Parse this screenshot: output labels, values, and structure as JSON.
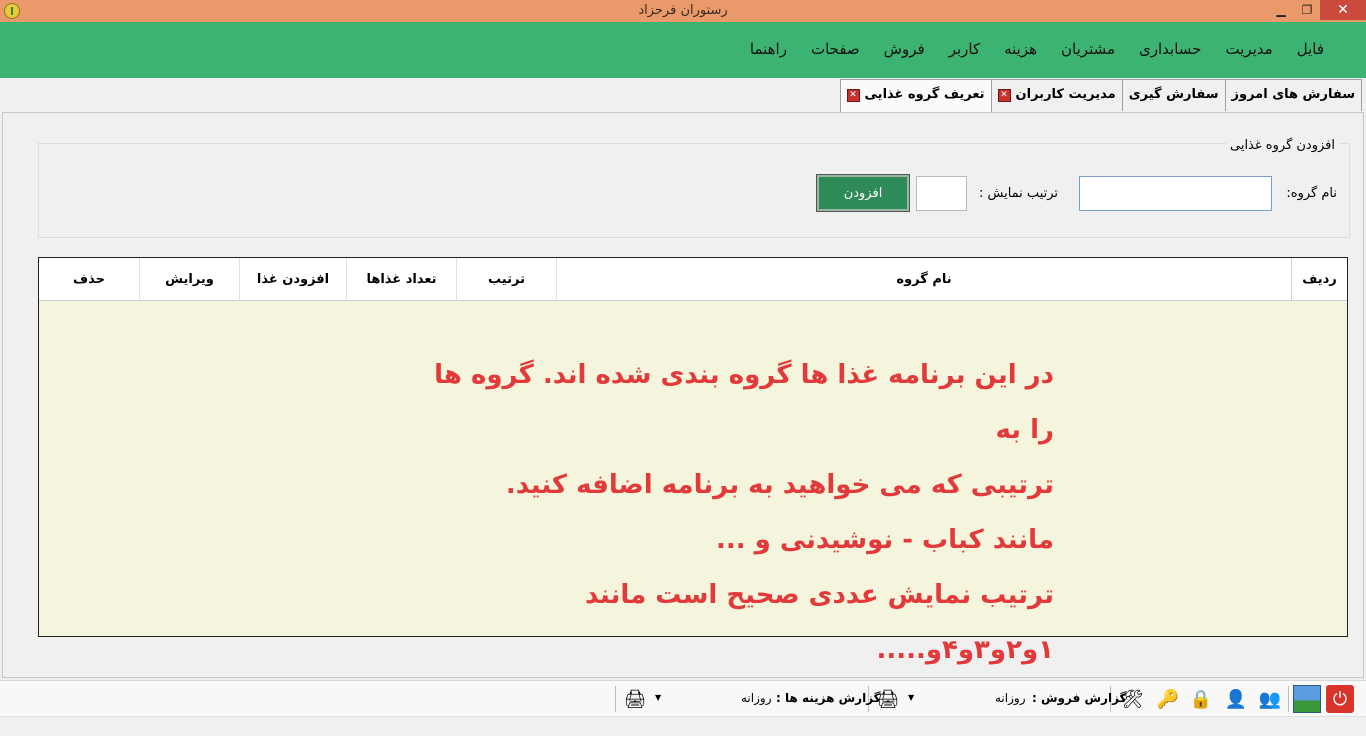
{
  "window": {
    "title": "رستوران فرحزاد",
    "minimize": "▁",
    "maximize": "❐",
    "close": "✕"
  },
  "menu": [
    "فایل",
    "مدیریت",
    "حسابداری",
    "مشتریان",
    "هزینه",
    "کاربر",
    "فروش",
    "صفحات",
    "راهنما"
  ],
  "tabs": [
    {
      "label": "سفارش های امروز",
      "closable": false
    },
    {
      "label": "سفارش گیری",
      "closable": false
    },
    {
      "label": "مدیریت کاربران",
      "closable": true
    },
    {
      "label": "تعریف گروه غذایی",
      "closable": true,
      "active": true
    }
  ],
  "form": {
    "legend": "افزودن گروه غذایی",
    "group_name_label": "نام گروه:",
    "group_name_value": "",
    "order_label": "ترتیب نمایش :",
    "order_value": "",
    "add_button": "افزودن"
  },
  "grid": {
    "columns": [
      "ردیف",
      "نام گروه",
      "ترتیب",
      "تعداد غذاها",
      "افزودن غذا",
      "ویرایش",
      "حذف"
    ],
    "notice_lines": [
      "در این برنامه غذا ها گروه بندی شده اند. گروه ها را به",
      "ترتیبی که می خواهید به برنامه اضافه کنید.",
      "مانند کباب - نوشیدنی و ...",
      "ترتیب نمایش عددی  صحیح است مانند ۱و۲و۳و۴و....."
    ]
  },
  "toolbar": {
    "sales_report_label": "گزارش فروش :",
    "sales_report_value": "روزانه",
    "expense_report_label": "گزارش هزینه ها :",
    "expense_report_value": "روزانه",
    "icons": [
      "power-icon",
      "picture-icon",
      "users-icon",
      "user-icon",
      "lock-icon",
      "key-icon",
      "tools-icon"
    ]
  },
  "colors": {
    "menubar": "#3cb371",
    "titlebar": "#ea9a6a",
    "notice": "#e23a3a",
    "grid_bg": "#f5f4dc",
    "add_button": "#2e8b57"
  }
}
